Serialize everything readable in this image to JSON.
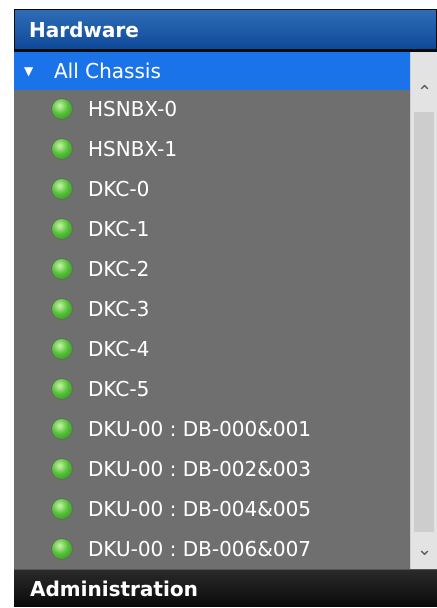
{
  "header": {
    "title": "Hardware"
  },
  "tree": {
    "root_label": "All Chassis",
    "items": [
      {
        "label": "HSNBX-0"
      },
      {
        "label": "HSNBX-1"
      },
      {
        "label": "DKC-0"
      },
      {
        "label": "DKC-1"
      },
      {
        "label": "DKC-2"
      },
      {
        "label": "DKC-3"
      },
      {
        "label": "DKC-4"
      },
      {
        "label": "DKC-5"
      },
      {
        "label": "DKU-00 : DB-000&001"
      },
      {
        "label": "DKU-00 : DB-002&003"
      },
      {
        "label": "DKU-00 : DB-004&005"
      },
      {
        "label": "DKU-00 : DB-006&007"
      }
    ]
  },
  "scrollbar": {
    "up_icon": "chevron-up-icon",
    "down_icon": "chevron-down-icon"
  },
  "footer": {
    "title": "Administration"
  },
  "colors": {
    "header_bg": "#1f5fae",
    "selected_bg": "#1a73e8",
    "tree_bg": "#6f6f6f",
    "status_ok": "#58c13a"
  }
}
